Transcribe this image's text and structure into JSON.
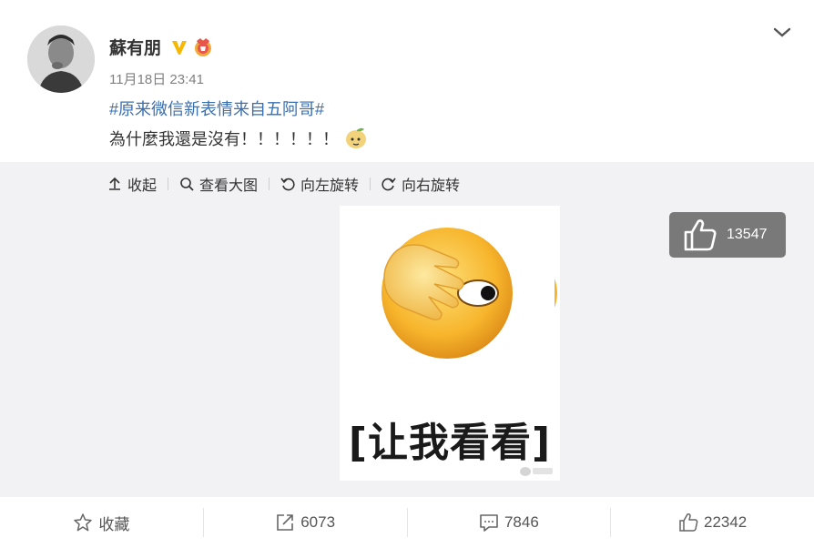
{
  "post": {
    "author": "蘇有朋",
    "timestamp": "11月18日 23:41",
    "topic": "#原来微信新表情来自五阿哥#",
    "text": "為什麼我還是沒有！！！！！！"
  },
  "media_toolbar": {
    "collapse": "收起",
    "view_large": "查看大图",
    "rotate_left": "向左旋转",
    "rotate_right": "向右旋转"
  },
  "image": {
    "caption": "[让我看看]"
  },
  "like_float": {
    "count": "13547"
  },
  "actions": {
    "favorite": "收藏",
    "repost": "6073",
    "comment": "7846",
    "like": "22342"
  },
  "colors": {
    "topic": "#3a6fb0",
    "media_bg": "#f2f2f5",
    "badge_gold": "#f6b800"
  }
}
